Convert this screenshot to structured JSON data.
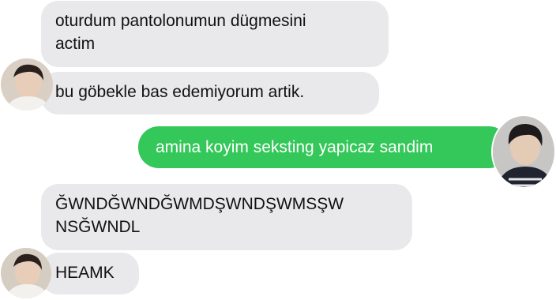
{
  "conversation": {
    "messages": [
      {
        "sender": "them",
        "text": "oturdum pantolonumun dügmesini\nactim"
      },
      {
        "sender": "them",
        "text": "bu göbekle bas edemiyorum artik."
      },
      {
        "sender": "me",
        "text": "amina koyim seksting yapicaz sandim"
      },
      {
        "sender": "them",
        "text": "ĞWNDĞWNDĞWMDŞWNDŞWMSŞW\nNSĞWNDL"
      },
      {
        "sender": "them",
        "text": "HEAMK"
      }
    ]
  },
  "avatars": {
    "them": "contact-avatar-photo",
    "me": "own-avatar-photo"
  },
  "colors": {
    "incoming_bubble": "#e9e9eb",
    "outgoing_bubble": "#34c759",
    "background": "#ffffff"
  }
}
